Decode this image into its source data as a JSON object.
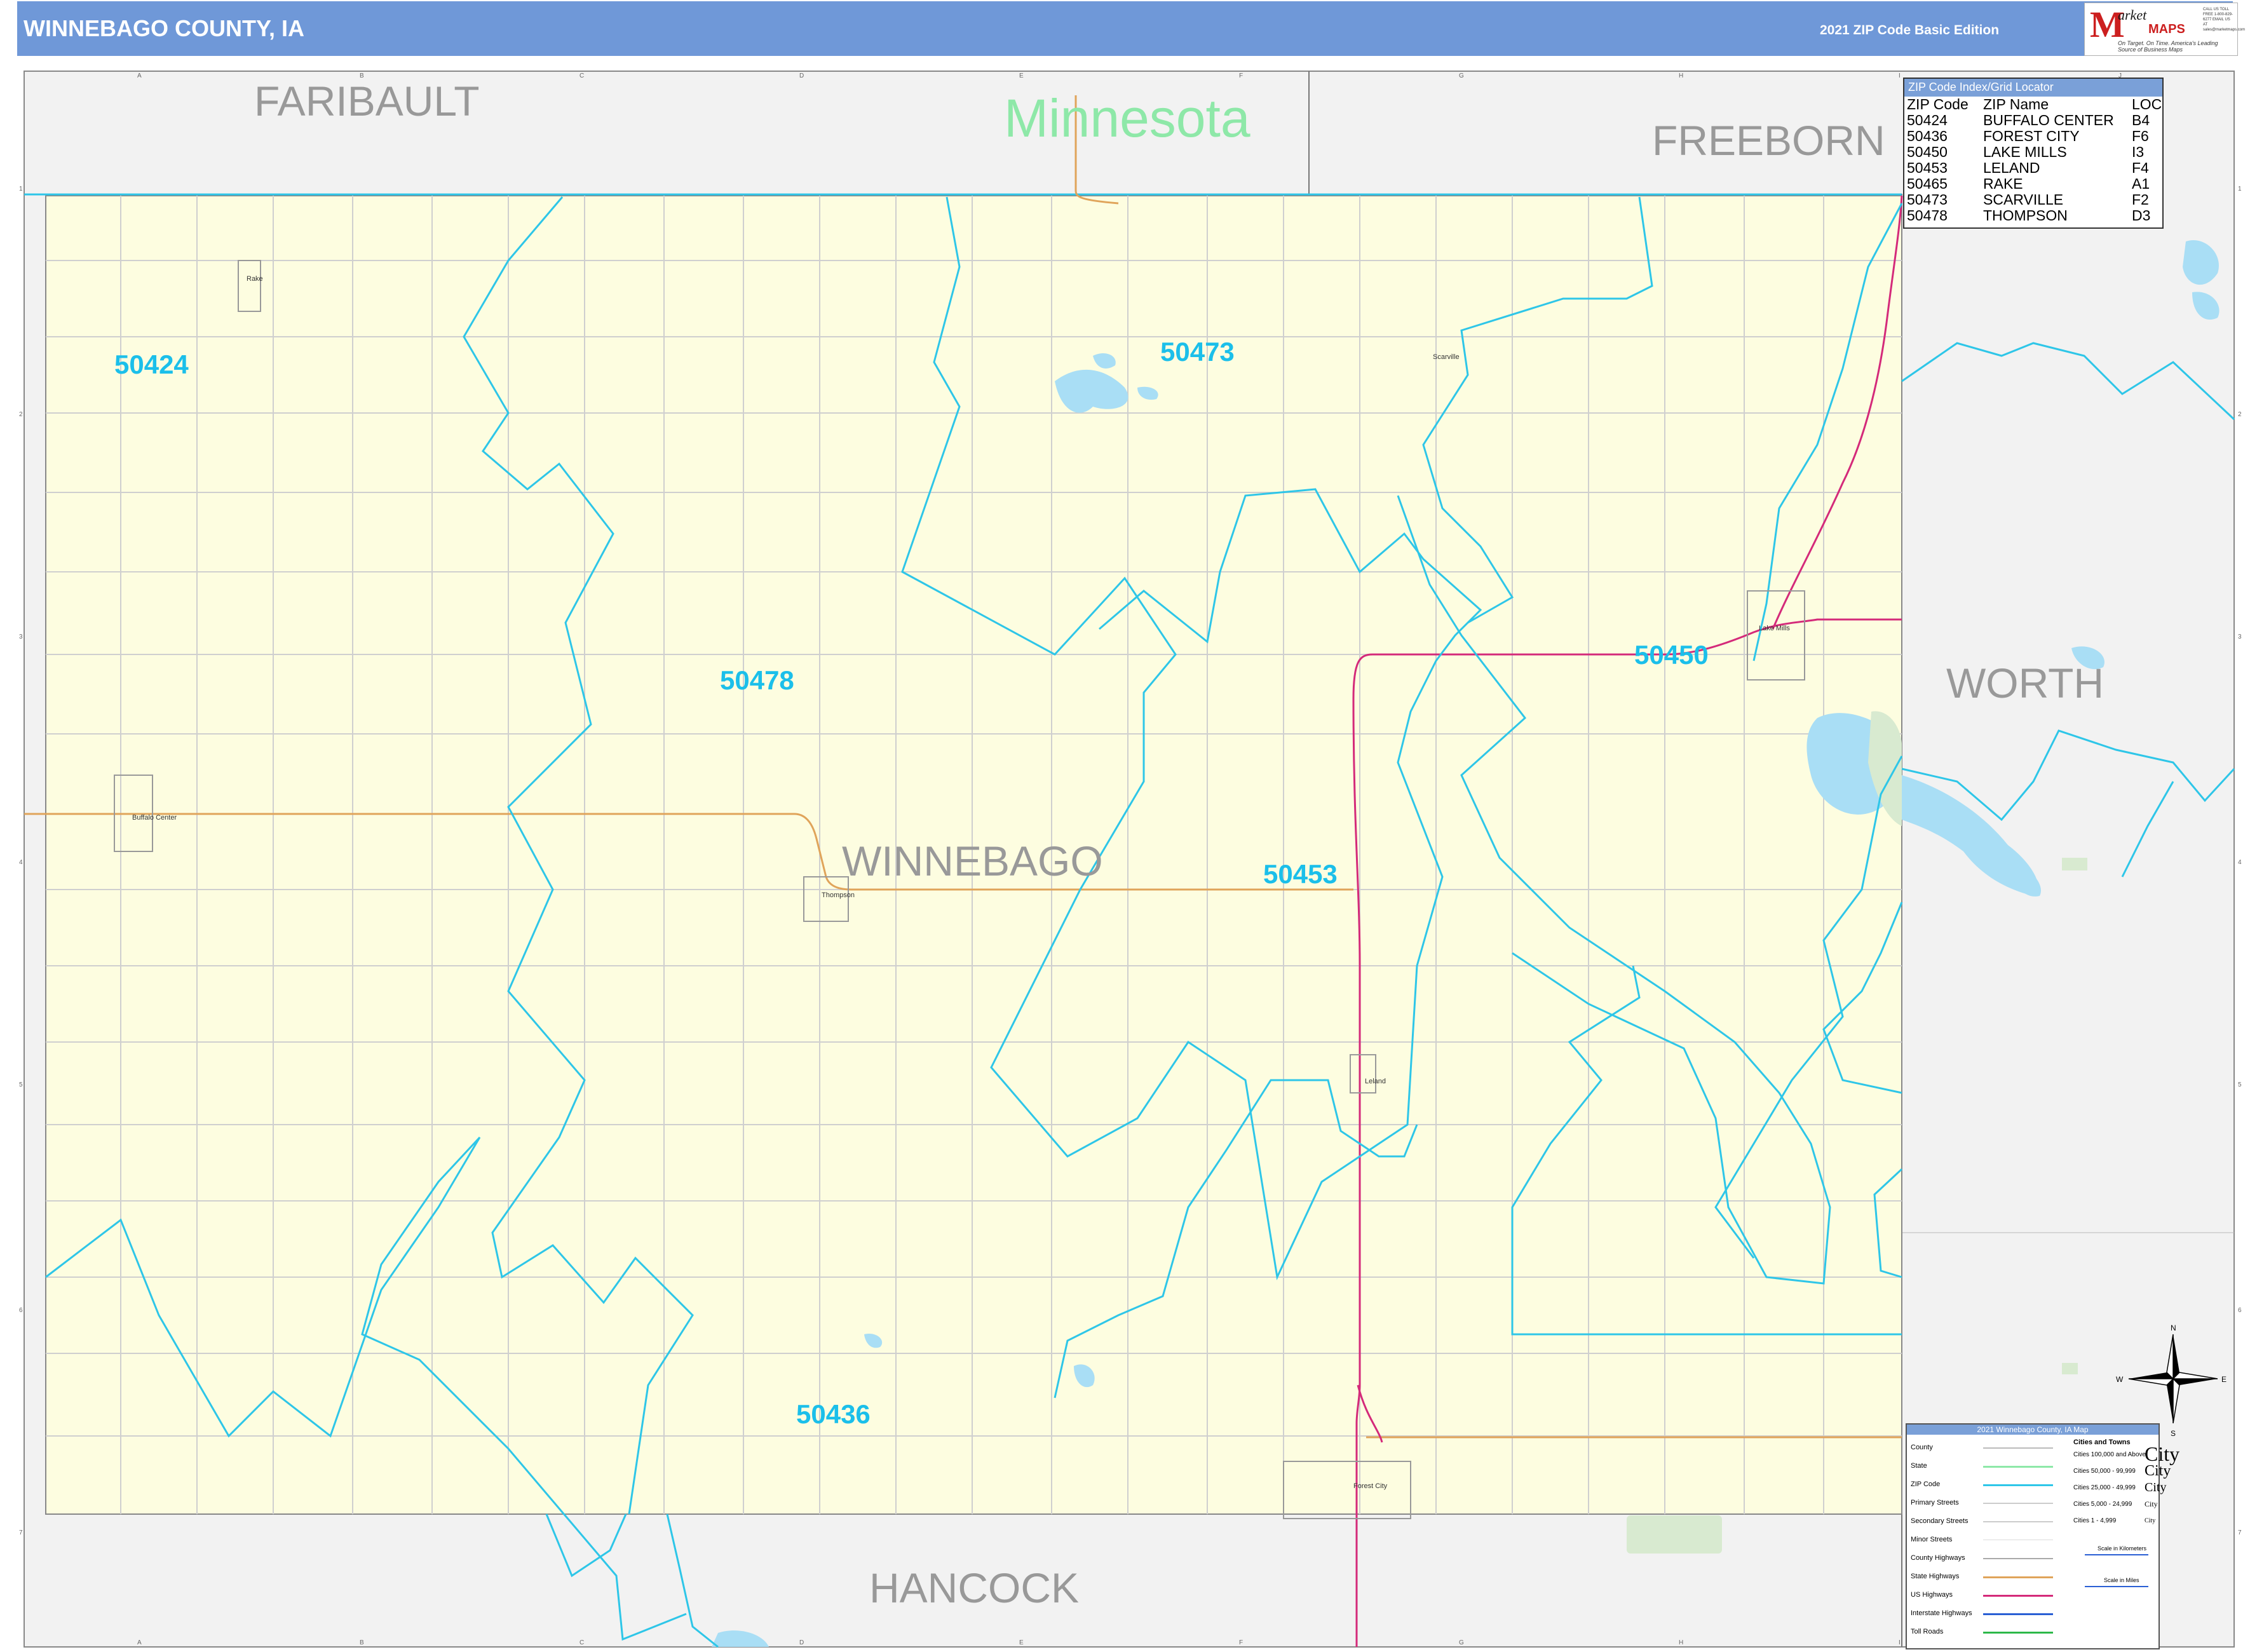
{
  "header": {
    "title": "WINNEBAGO COUNTY, IA",
    "edition": "2021 ZIP Code Basic Edition",
    "logo": {
      "brand_m": "M",
      "brand_market": "arket",
      "brand_maps": "MAPS",
      "tagline": "On Target. On Time. America's Leading Source of Business Maps",
      "contact": "CALL US TOLL FREE 1-800-829-6277 EMAIL US AT sales@marketmaps.com"
    }
  },
  "grid": {
    "columns": [
      "A",
      "B",
      "C",
      "D",
      "E",
      "F",
      "G",
      "H",
      "I",
      "J"
    ],
    "rows": [
      "1",
      "2",
      "3",
      "4",
      "5",
      "6",
      "7"
    ]
  },
  "labels": {
    "state": "Minnesota",
    "counties": [
      "FARIBAULT",
      "FREEBORN",
      "WORTH",
      "HANCOCK",
      "WINNEBAGO"
    ],
    "zips": [
      "50424",
      "50473",
      "50478",
      "50450",
      "50453",
      "50436"
    ],
    "towns": [
      "Rake",
      "Scarville",
      "Buffalo Center",
      "Thompson",
      "Lake Mills",
      "Leland",
      "Forest City"
    ]
  },
  "zip_index": {
    "title": "ZIP Code Index/Grid Locator",
    "headers": [
      "ZIP Code",
      "ZIP Name",
      "LOC"
    ],
    "rows": [
      [
        "50424",
        "BUFFALO CENTER",
        "B4"
      ],
      [
        "50436",
        "FOREST CITY",
        "F6"
      ],
      [
        "50450",
        "LAKE MILLS",
        "I3"
      ],
      [
        "50453",
        "LELAND",
        "F4"
      ],
      [
        "50465",
        "RAKE",
        "A1"
      ],
      [
        "50473",
        "SCARVILLE",
        "F2"
      ],
      [
        "50478",
        "THOMPSON",
        "D3"
      ]
    ]
  },
  "legend": {
    "title": "2021 Winnebago County, IA Map",
    "items": [
      "County",
      "State",
      "ZIP Code",
      "Primary Streets",
      "Secondary Streets",
      "Minor Streets",
      "County Highways",
      "State Highways",
      "US Highways",
      "Interstate Highways",
      "Toll Roads"
    ],
    "cities_heading": "Cities and Towns",
    "city_classes": [
      "Cities 100,000 and Above",
      "Cities 50,000 - 99,999",
      "Cities 25,000 - 49,999",
      "Cities 5,000 - 24,999",
      "Cities 1 - 4,999"
    ],
    "city_word": "City",
    "scale_km": "Scale in Kilometers",
    "scale_mi": "Scale in Miles"
  },
  "compass": {
    "n": "N",
    "s": "S",
    "e": "E",
    "w": "W"
  },
  "colors": {
    "header": "#6f98d8",
    "county_fill": "#fdfde0",
    "outside_fill": "#f2f2f2",
    "zip_line": "#2ec6e8",
    "zip_label": "#1bbfea",
    "us_highway": "#d42a7a",
    "state_highway": "#e0a45a",
    "water": "#a9def5",
    "park": "#d8ead0"
  }
}
